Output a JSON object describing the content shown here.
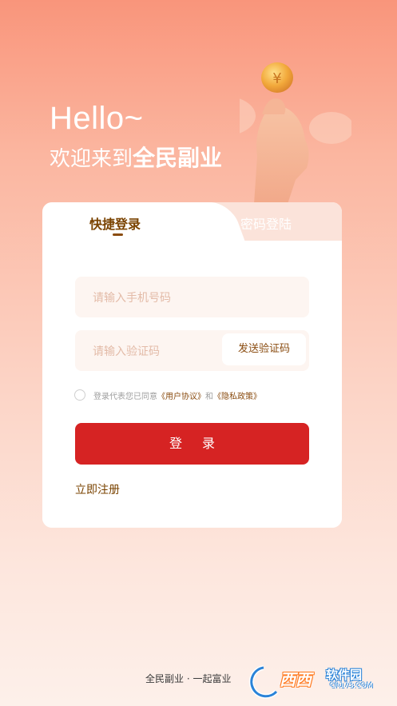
{
  "header": {
    "hello": "Hello~",
    "welcome_prefix": "欢迎来到",
    "app_name": "全民副业"
  },
  "tabs": {
    "quick_login": "快捷登录",
    "password_login": "密码登陆"
  },
  "form": {
    "phone_placeholder": "请输入手机号码",
    "code_placeholder": "请输入验证码",
    "send_code_label": "发送验证码",
    "agree_prefix": "登录代表您已同意",
    "user_agreement": "《用户协议》",
    "and": "和",
    "privacy_policy": "《隐私政策》",
    "login_label": "登 录",
    "register_label": "立即注册"
  },
  "footer": {
    "slogan": "全民副业 · 一起富业"
  },
  "watermark": {
    "brand": "西西",
    "soft": "软件园",
    "url": "CR173.COM"
  },
  "colors": {
    "accent": "#d62323",
    "brown": "#7a4300",
    "coin": "#f2a93b"
  }
}
